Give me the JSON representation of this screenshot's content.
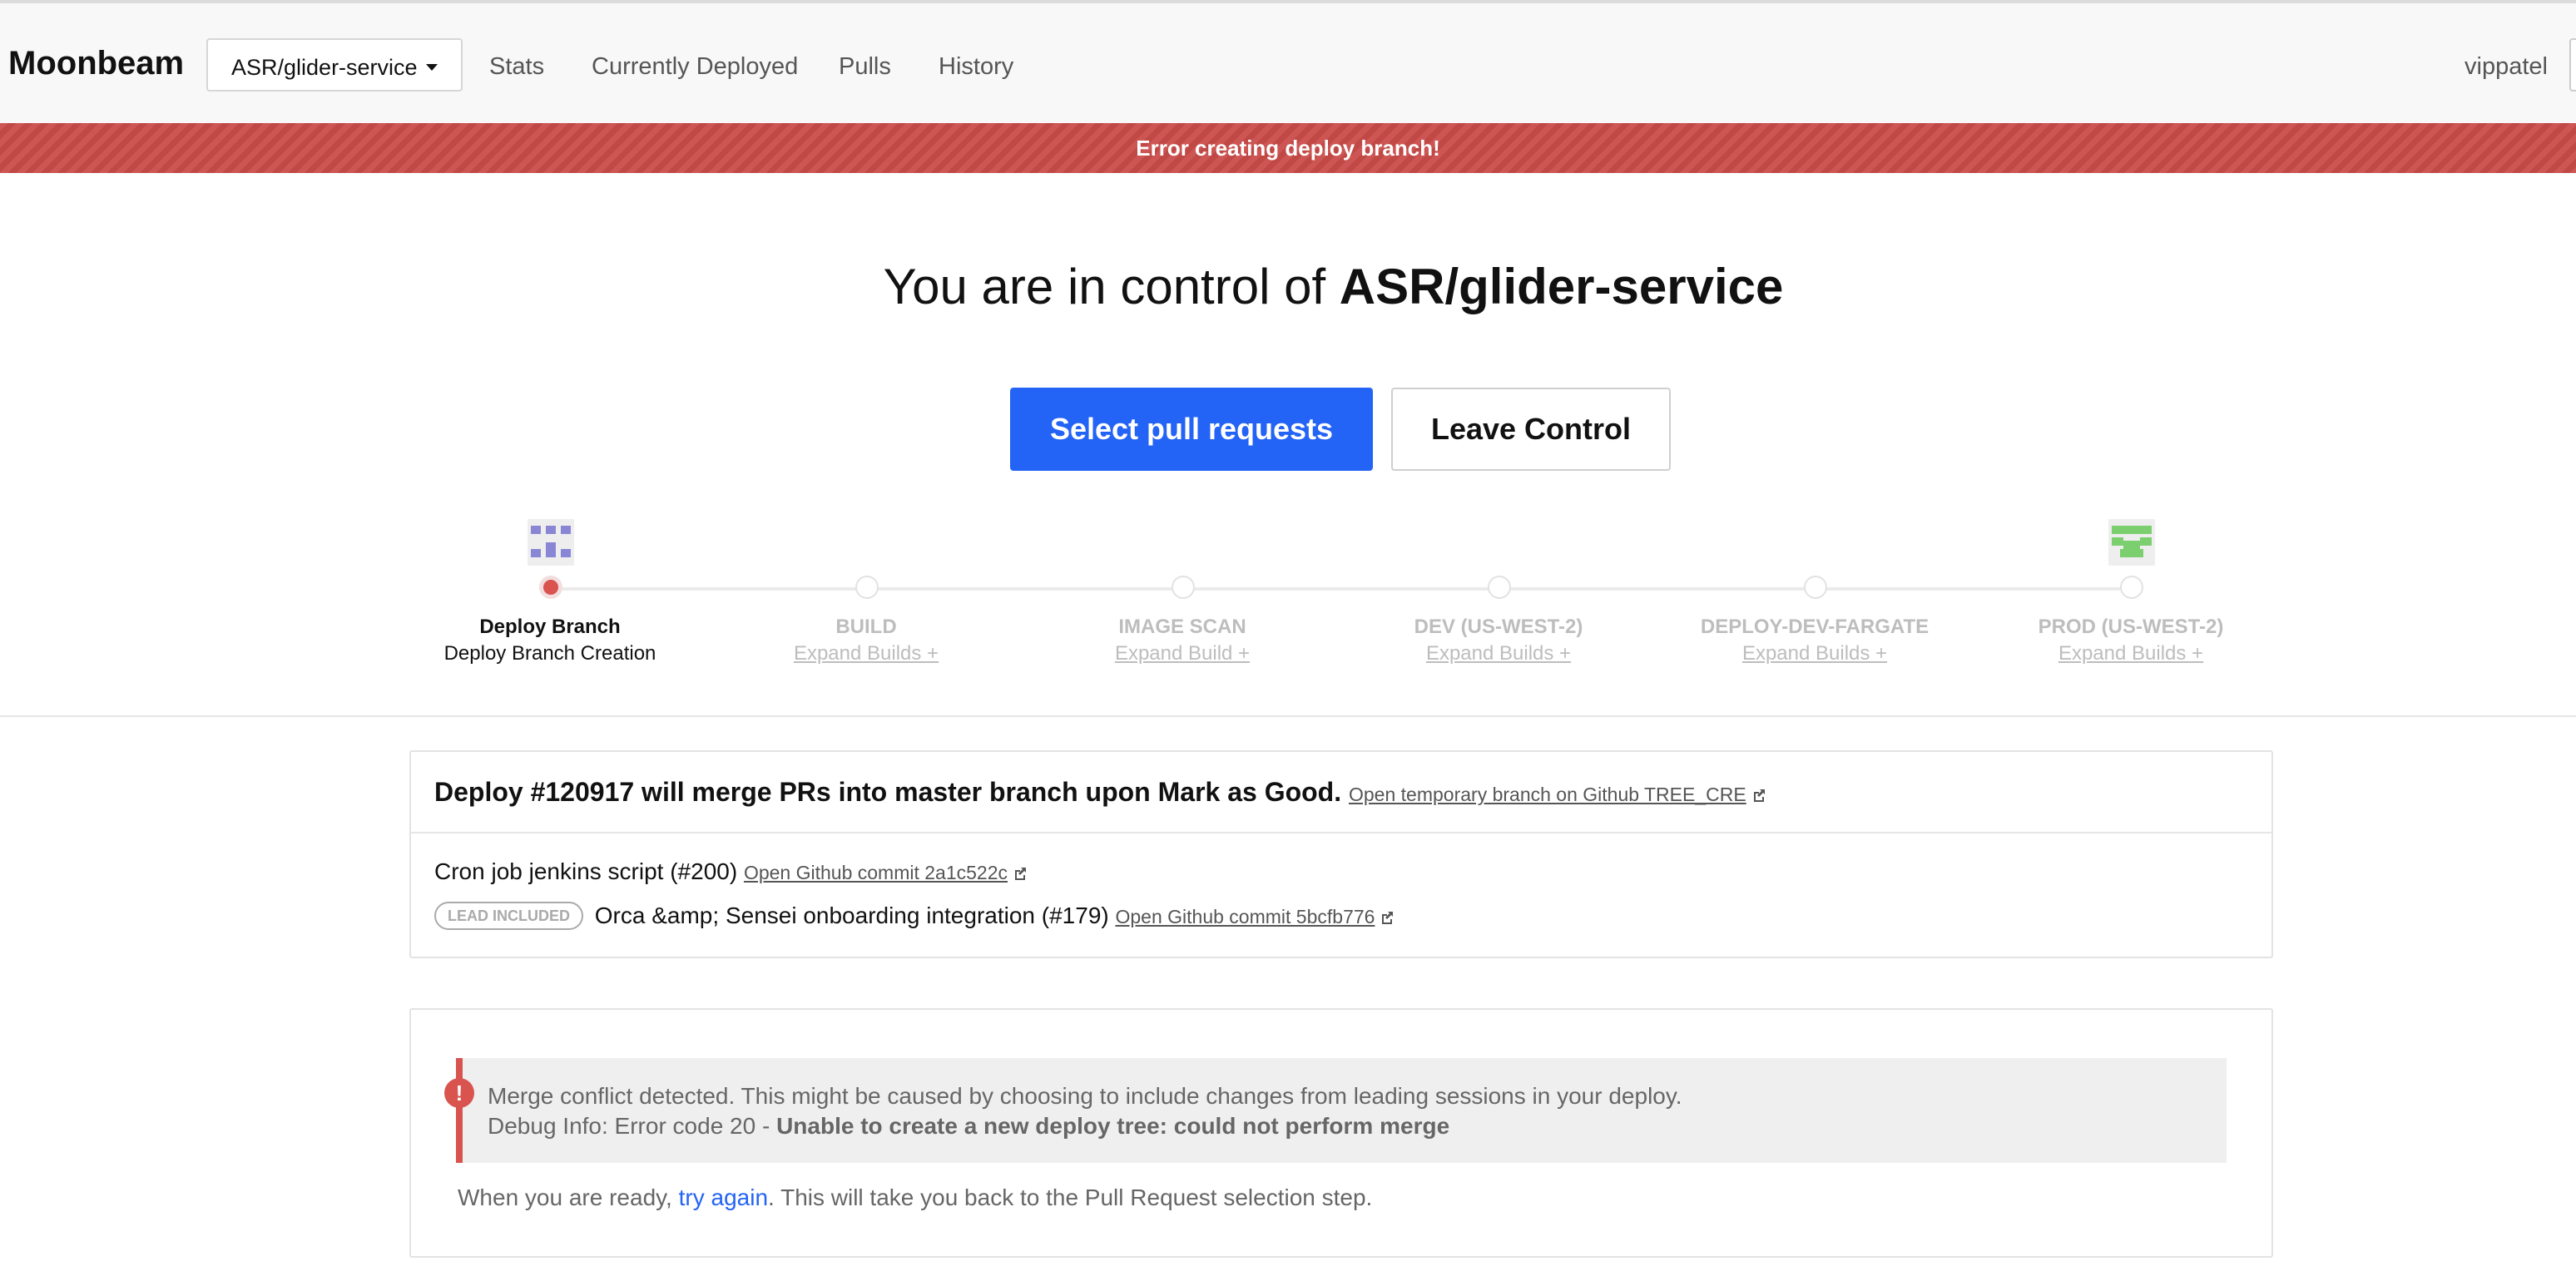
{
  "nav": {
    "brand": "Moonbeam",
    "repo_select": "ASR/glider-service",
    "links": [
      "Stats",
      "Currently Deployed",
      "Pulls",
      "History"
    ],
    "user": "vippatel"
  },
  "banner": {
    "text": "Error creating deploy branch!"
  },
  "control": {
    "prefix": "You are in control of ",
    "repo": "ASR/glider-service",
    "primary_button": "Select pull requests",
    "secondary_button": "Leave Control"
  },
  "pipeline": {
    "stages": [
      {
        "title": "Deploy Branch",
        "sub": "Deploy Branch Creation",
        "active": true
      },
      {
        "title": "BUILD",
        "sub": "Expand Builds +",
        "active": false
      },
      {
        "title": "IMAGE SCAN",
        "sub": "Expand Build +",
        "active": false
      },
      {
        "title": "DEV (US-WEST-2)",
        "sub": "Expand Builds +",
        "active": false
      },
      {
        "title": "DEPLOY-DEV-FARGATE",
        "sub": "Expand Builds +",
        "active": false
      },
      {
        "title": "PROD (US-WEST-2)",
        "sub": "Expand Builds +",
        "active": false
      }
    ]
  },
  "deploy": {
    "title": "Deploy #120917 will merge PRs into master branch upon Mark as Good.",
    "branch_link": "Open temporary branch on Github TREE_CRE",
    "prs": [
      {
        "badge": "",
        "name": "Cron job jenkins script (#200)",
        "link": "Open Github commit 2a1c522c"
      },
      {
        "badge": "LEAD INCLUDED",
        "name": "Orca &amp; Sensei onboarding integration (#179)",
        "link": "Open Github commit 5bcfb776"
      }
    ]
  },
  "error": {
    "icon": "!",
    "line1": "Merge conflict detected. This might be caused by choosing to include changes from leading sessions in your deploy.",
    "line2_prefix": "Debug Info: Error code 20 - ",
    "line2_bold": "Unable to create a new deploy tree: could not perform merge",
    "ready_prefix": "When you are ready, ",
    "ready_link": "try again",
    "ready_suffix": ". This will take you back to the Pull Request selection step."
  }
}
